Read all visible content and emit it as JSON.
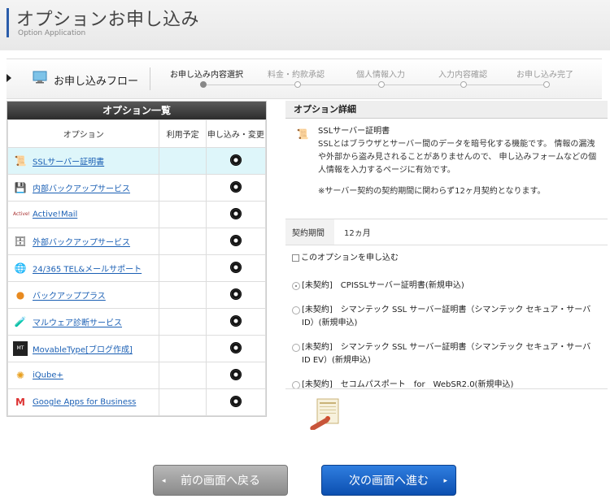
{
  "header": {
    "title": "オプションお申し込み",
    "subtitle": "Option Application"
  },
  "flow": {
    "label": "お申し込みフロー",
    "steps": [
      {
        "label": "お申し込み内容選択",
        "active": true
      },
      {
        "label": "料金・約款承認",
        "active": false
      },
      {
        "label": "個人情報入力",
        "active": false
      },
      {
        "label": "入力内容確認",
        "active": false
      },
      {
        "label": "お申し込み完了",
        "active": false
      }
    ]
  },
  "options_panel": {
    "title": "オプション一覧",
    "columns": [
      "オプション",
      "利用予定",
      "申し込み・変更"
    ],
    "rows": [
      {
        "name": "SSLサーバー証明書",
        "icon": "certificate-icon",
        "selected": true
      },
      {
        "name": "内部バックアップサービス",
        "icon": "backup-icon",
        "selected": false
      },
      {
        "name": "Active!Mail",
        "icon": "activemail-logo",
        "selected": false
      },
      {
        "name": "外部バックアップサービス",
        "icon": "external-backup-icon",
        "selected": false
      },
      {
        "name": "24/365 TEL&メールサポート",
        "icon": "globe-support-icon",
        "selected": false
      },
      {
        "name": "バックアッププラス",
        "icon": "backup-plus-icon",
        "selected": false
      },
      {
        "name": "マルウェア診断サービス",
        "icon": "malware-icon",
        "selected": false
      },
      {
        "name": "MovableType[ブログ作成]",
        "icon": "movabletype-logo",
        "selected": false
      },
      {
        "name": "iQube+",
        "icon": "iqube-logo",
        "selected": false
      },
      {
        "name": "Google Apps for Business",
        "icon": "gmail-icon",
        "selected": false
      }
    ]
  },
  "detail": {
    "heading": "オプション詳細",
    "title": "SSLサーバー証明書",
    "description": "SSLとはブラウザとサーバー間のデータを暗号化する機能です。 情報の漏洩や外部から盗み見されることがありませんので、 申し込みフォームなどの個人情報を入力するページに有効です。",
    "note": "※サーバー契約の契約期間に関わらず12ヶ月契約となります。",
    "term_label": "契約期間",
    "term_value": "12ヵ月",
    "apply_label": "このオプションを申し込む",
    "plans": [
      {
        "label": "[未契約]　CPISSLサーバー証明書(新規申込)",
        "checked": true
      },
      {
        "label": "[未契約]　シマンテック SSL サーバー証明書（シマンテック セキュア・サーバ ID）(新規申込)",
        "checked": false
      },
      {
        "label": "[未契約]　シマンテック SSL サーバー証明書（シマンテック セキュア・サーバ ID EV）(新規申込)",
        "checked": false
      },
      {
        "label": "[未契約]　セコムパスポート　for　WebSR2.0(新規申込)",
        "checked": false
      }
    ]
  },
  "buttons": {
    "back": "前の画面へ戻る",
    "next": "次の画面へ進む"
  },
  "colors": {
    "accent": "#2a5caa",
    "link": "#1a5fb4",
    "selected_row": "#def6fa",
    "next_button": "#1a66cc"
  }
}
